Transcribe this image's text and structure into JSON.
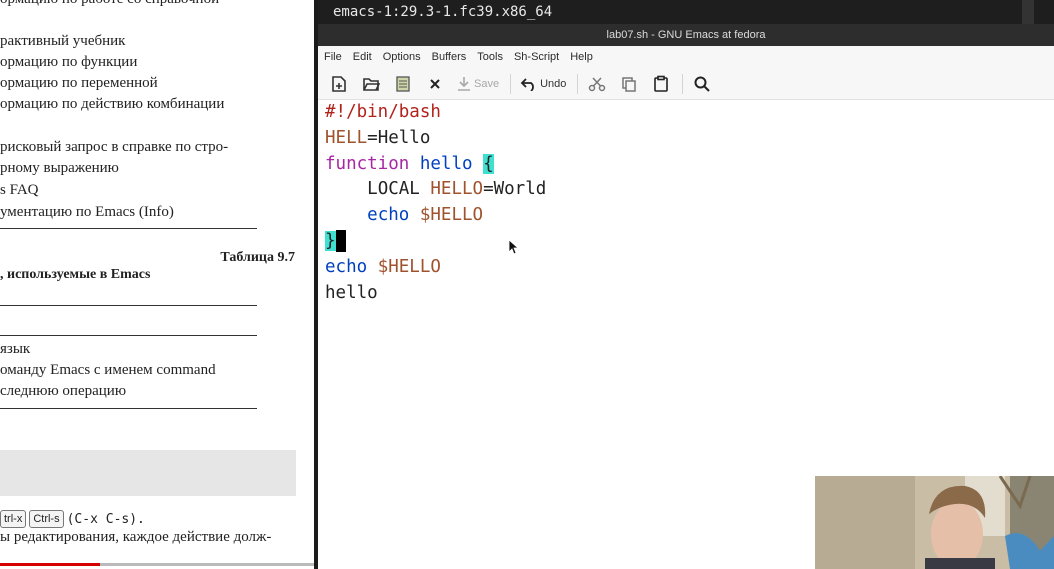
{
  "document": {
    "lines_top": [
      "ормацию по работе со справочной",
      "рактивный учебник",
      "ормацию по функции",
      "ормацию по переменной",
      "ормацию по действию комбинации",
      "рисковый запрос в справке по стро-",
      "рному выражению",
      "s FAQ",
      "ументацию по Emacs (Info)"
    ],
    "table_number": "Таблица 9.7",
    "table_caption": ", используемые в Emacs",
    "lines_mid": [
      "язык",
      "оманду Emacs с именем command",
      "следнюю операцию"
    ],
    "key1": "trl-x",
    "key2": "Ctrl-s",
    "key_combo": "(C-x C-s).",
    "last_line": "ы редактирования, каждое действие долж-"
  },
  "terminal": {
    "text": "emacs-1:29.3-1.fc39.x86_64"
  },
  "emacs": {
    "title": "lab07.sh - GNU Emacs at fedora",
    "menu": [
      "File",
      "Edit",
      "Options",
      "Buffers",
      "Tools",
      "Sh-Script",
      "Help"
    ],
    "toolbar": {
      "save": "Save",
      "undo": "Undo"
    },
    "code": {
      "l1": "#!/bin/bash",
      "l2_var": "HELL",
      "l2_rest": "=Hello",
      "l3_kw": "function",
      "l3_name": "hello",
      "l3_brace": "{",
      "l4_kw": "LOCAL",
      "l4_var": "HELLO",
      "l4_rest": "=World",
      "l5_cmd": "echo",
      "l5_var": "$HELLO",
      "l6_brace": "}",
      "l7_cmd": "echo",
      "l7_var": "$HELLO",
      "l8": "hello"
    }
  },
  "colors": {
    "keyword": "#a626a4",
    "function_name": "#0040c0",
    "variable": "#a0522d",
    "paren_match": "#40e0d0"
  }
}
